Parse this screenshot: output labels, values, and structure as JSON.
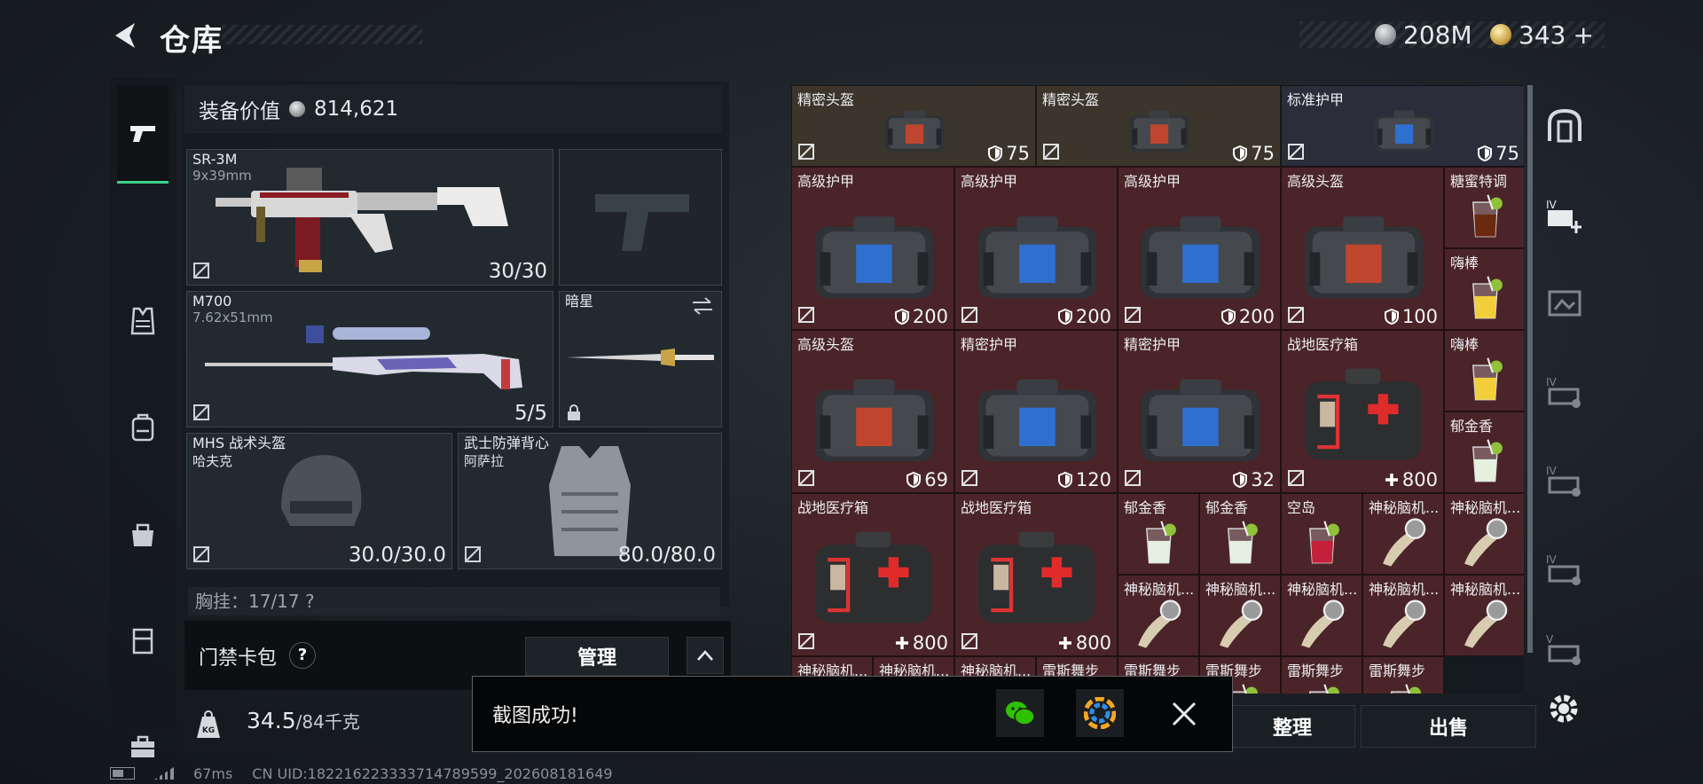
{
  "header": {
    "title": "仓库",
    "silver_amount": "208M",
    "gold_amount": "343",
    "gold_plus": "+"
  },
  "loadout": {
    "value_label": "装备价值",
    "value": "814,621",
    "primary": {
      "name": "SR-3M",
      "caliber": "9x39mm",
      "ammo": "30/30"
    },
    "secondary": {
      "name": "M700",
      "caliber": "7.62x51mm",
      "ammo": "5/5"
    },
    "melee": {
      "name": "暗星"
    },
    "helmet": {
      "name": "MHS 战术头盔",
      "sub": "哈夫克",
      "durability": "30.0/30.0"
    },
    "armor": {
      "name": "武士防弹背心",
      "sub": "阿萨拉",
      "durability": "80.0/80.0"
    },
    "chest_partial": "胸挂：17/17  ?"
  },
  "access_card": {
    "label": "门禁卡包",
    "help": "?",
    "manage": "管理"
  },
  "weight": {
    "current": "34.5",
    "max": "/84千克"
  },
  "inventory": {
    "cells": [
      {
        "name": "精密头盔",
        "value": "75",
        "kind": "bag",
        "bg": "#3b352c",
        "accent": "#c0452f"
      },
      {
        "name": "精密头盔",
        "value": "75",
        "kind": "bag",
        "bg": "#3b352c",
        "accent": "#c0452f"
      },
      {
        "name": "标准护甲",
        "value": "75",
        "kind": "bag",
        "bg": "#2b2d3a",
        "accent": "#2f6fd0"
      },
      {
        "name": "高级护甲",
        "value": "200",
        "kind": "bag",
        "bg": "#4a2428",
        "accent": "#2f6fd0"
      },
      {
        "name": "高级护甲",
        "value": "200",
        "kind": "bag",
        "bg": "#4a2428",
        "accent": "#2f6fd0"
      },
      {
        "name": "高级护甲",
        "value": "200",
        "kind": "bag",
        "bg": "#4a2428",
        "accent": "#2f6fd0"
      },
      {
        "name": "高级头盔",
        "value": "100",
        "kind": "bag",
        "bg": "#4a2428",
        "accent": "#c0452f"
      },
      {
        "name": "糖蜜特调",
        "kind": "drink-dark",
        "bg": "#4a2428"
      },
      {
        "name": "嗨棒",
        "kind": "drink-yellow",
        "bg": "#4a2428"
      },
      {
        "name": "高级头盔",
        "value": "69",
        "kind": "bag",
        "bg": "#4a2428",
        "accent": "#c0452f"
      },
      {
        "name": "精密护甲",
        "value": "120",
        "kind": "bag",
        "bg": "#4a2428",
        "accent": "#2f6fd0"
      },
      {
        "name": "精密护甲",
        "value": "32",
        "kind": "bag",
        "bg": "#4a2428",
        "accent": "#2f6fd0"
      },
      {
        "name": "战地医疗箱",
        "value": "800",
        "kind": "medkit",
        "bg": "#4a2428"
      },
      {
        "name": "嗨棒",
        "kind": "drink-yellow",
        "bg": "#4a2428"
      },
      {
        "name": "郁金香",
        "kind": "drink-clear",
        "bg": "#4a2428"
      },
      {
        "name": "战地医疗箱",
        "value": "800",
        "kind": "medkit",
        "bg": "#4a2428"
      },
      {
        "name": "战地医疗箱",
        "value": "800",
        "kind": "medkit",
        "bg": "#4a2428"
      },
      {
        "name": "郁金香",
        "kind": "drink-clear",
        "bg": "#4a2428"
      },
      {
        "name": "郁金香",
        "kind": "drink-clear",
        "bg": "#4a2428"
      },
      {
        "name": "空岛",
        "kind": "drink-red",
        "bg": "#4a2428"
      },
      {
        "name": "神秘脑机...",
        "kind": "tool",
        "bg": "#4a2428"
      },
      {
        "name": "神秘脑机...",
        "kind": "tool",
        "bg": "#4a2428"
      },
      {
        "name": "神秘脑机...",
        "kind": "tool",
        "bg": "#4a2428"
      },
      {
        "name": "神秘脑机...",
        "kind": "tool",
        "bg": "#4a2428"
      },
      {
        "name": "神秘脑机...",
        "kind": "tool",
        "bg": "#4a2428"
      },
      {
        "name": "神秘脑机...",
        "kind": "tool",
        "bg": "#4a2428"
      },
      {
        "name": "神秘脑机...",
        "kind": "tool",
        "bg": "#4a2428"
      },
      {
        "name": "神秘脑机...",
        "kind": "tool",
        "bg": "#4a2428"
      },
      {
        "name": "神秘脑机...",
        "kind": "tool",
        "bg": "#4a2428"
      },
      {
        "name": "神秘脑机...",
        "kind": "tool",
        "bg": "#4a2428"
      },
      {
        "name": "雷斯舞步",
        "kind": "drink-red",
        "bg": "#4a2428"
      },
      {
        "name": "雷斯舞步",
        "kind": "drink-red",
        "bg": "#4a2428"
      },
      {
        "name": "雷斯舞步",
        "kind": "drink-red",
        "bg": "#4a2428"
      },
      {
        "name": "雷斯舞步",
        "kind": "drink-red",
        "bg": "#4a2428"
      },
      {
        "name": "雷斯舞步",
        "kind": "drink-red",
        "bg": "#4a2428"
      }
    ]
  },
  "actions": {
    "sort": "整理",
    "sell": "出售"
  },
  "toast": {
    "text": "截图成功!"
  },
  "footer": {
    "ping": "67ms",
    "uid": "CN UID:18221622333371478959​9_202608181649"
  },
  "colors": {
    "accent_green": "#3fd08a"
  }
}
